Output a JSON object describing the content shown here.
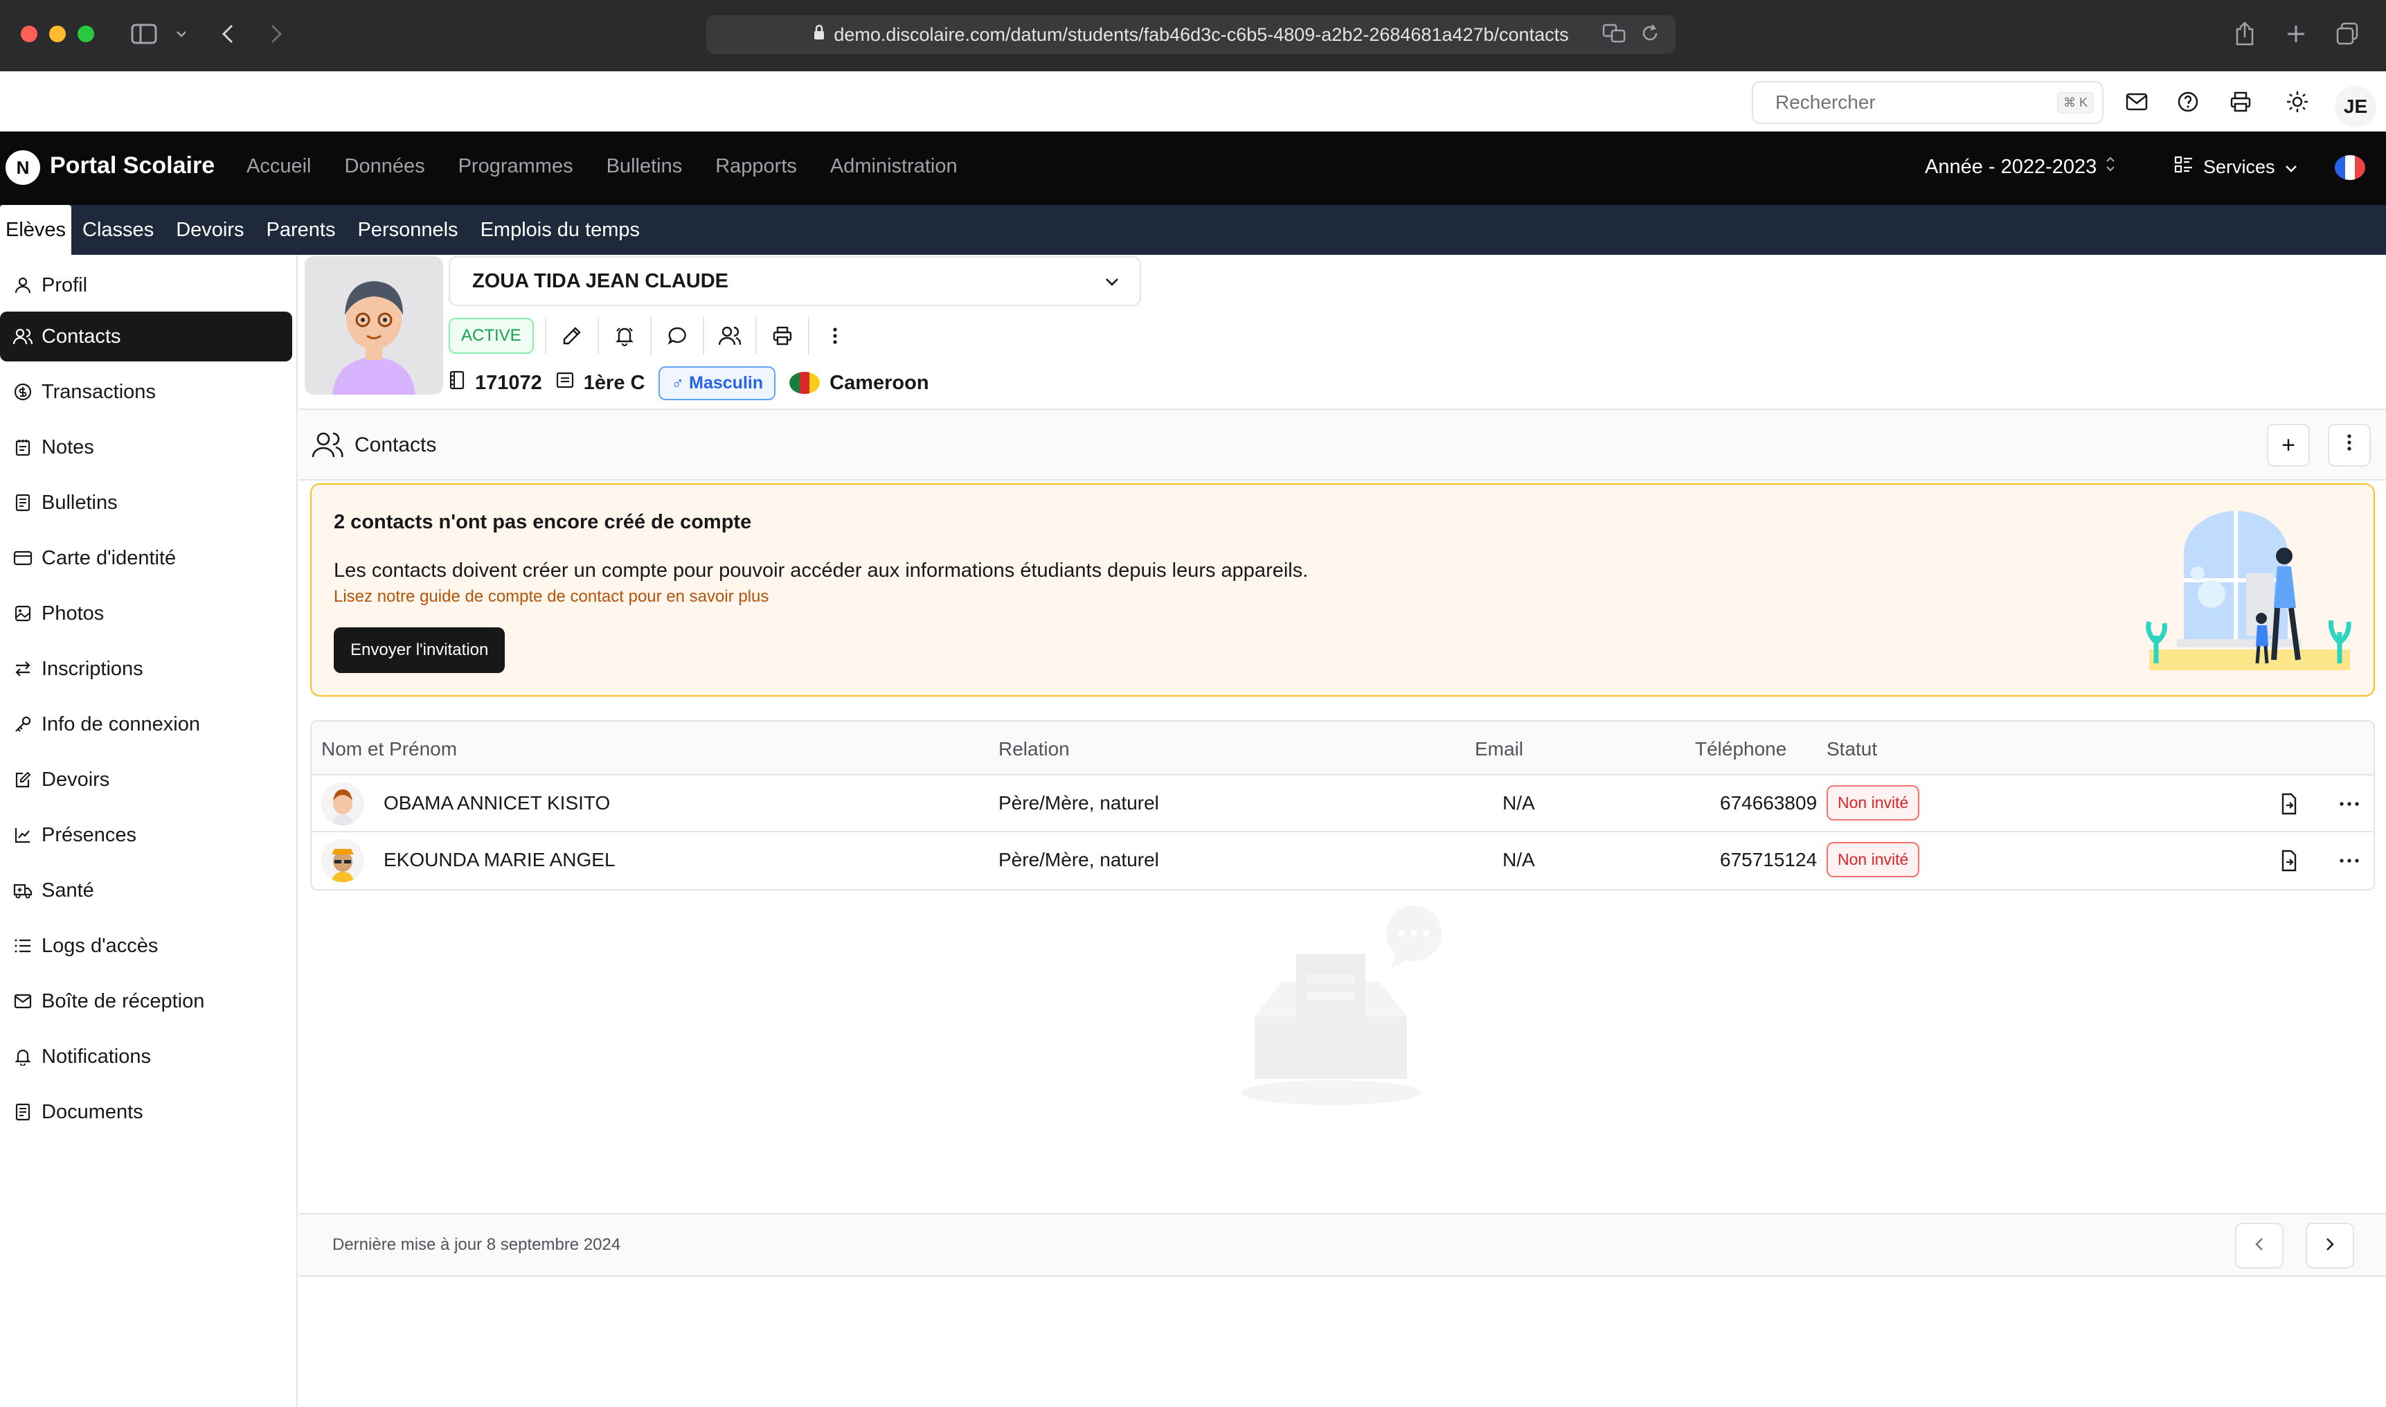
{
  "browser": {
    "url": "demo.discolaire.com/datum/students/fab46d3c-c6b5-4809-a2b2-2684681a427b/contacts"
  },
  "util": {
    "search_placeholder": "Rechercher",
    "search_kbd": "⌘ K",
    "user_initials": "JE"
  },
  "nav": {
    "brand_letter": "N",
    "brand": "Portal Scolaire",
    "links": [
      "Accueil",
      "Données",
      "Programmes",
      "Bulletins",
      "Rapports",
      "Administration"
    ],
    "year_label": "Année -  2022-2023",
    "services_label": "Services"
  },
  "subnav": {
    "tabs": [
      "Elèves",
      "Classes",
      "Devoirs",
      "Parents",
      "Personnels",
      "Emplois du temps"
    ]
  },
  "sidebar": {
    "items": [
      {
        "label": "Profil",
        "icon": "user-icon"
      },
      {
        "label": "Contacts",
        "icon": "users-icon"
      },
      {
        "label": "Transactions",
        "icon": "dollar-icon"
      },
      {
        "label": "Notes",
        "icon": "notes-icon"
      },
      {
        "label": "Bulletins",
        "icon": "document-icon"
      },
      {
        "label": "Carte d'identité",
        "icon": "id-card-icon"
      },
      {
        "label": "Photos",
        "icon": "image-icon"
      },
      {
        "label": "Inscriptions",
        "icon": "swap-icon"
      },
      {
        "label": "Info de connexion",
        "icon": "key-icon"
      },
      {
        "label": "Devoirs",
        "icon": "edit-icon"
      },
      {
        "label": "Présences",
        "icon": "chart-icon"
      },
      {
        "label": "Santé",
        "icon": "ambulance-icon"
      },
      {
        "label": "Logs d'accès",
        "icon": "list-icon"
      },
      {
        "label": "Boîte de réception",
        "icon": "mail-icon"
      },
      {
        "label": "Notifications",
        "icon": "bell-icon"
      },
      {
        "label": "Documents",
        "icon": "document-icon"
      }
    ]
  },
  "student": {
    "name": "ZOUA TIDA JEAN CLAUDE",
    "status": "ACTIVE",
    "matricule": "171072",
    "classroom": "1ère C",
    "gender": "♂ Masculin",
    "country": "Cameroon"
  },
  "section": {
    "title": "Contacts",
    "add": "+"
  },
  "alert": {
    "title": "2 contacts n'ont pas encore créé de compte",
    "text": "Les contacts doivent créer un compte pour pouvoir accéder aux informations étudiants depuis leurs appareils.",
    "link": "Lisez notre guide de compte de contact pour en savoir plus",
    "button": "Envoyer l'invitation"
  },
  "table": {
    "headers": {
      "name": "Nom et Prénom",
      "relation": "Relation",
      "email": "Email",
      "phone": "Téléphone",
      "status": "Statut"
    },
    "rows": [
      {
        "name": "OBAMA ANNICET KISITO",
        "relation": "Père/Mère, naturel",
        "email": "N/A",
        "phone": "674663809",
        "status": "Non invité"
      },
      {
        "name": "EKOUNDA MARIE ANGEL",
        "relation": "Père/Mère, naturel",
        "email": "N/A",
        "phone": "675715124",
        "status": "Non invité"
      }
    ]
  },
  "footer": {
    "updated": "Dernière mise à jour 8 septembre 2024"
  },
  "colors": {
    "nav_bg": "#0a0a0a",
    "subnav_bg": "#1e293b",
    "alert_border": "#fbbf24",
    "alert_bg": "#fff7ed",
    "active_green": "#16a34a",
    "danger_red": "#dc2626",
    "gender_blue": "#2563eb"
  }
}
